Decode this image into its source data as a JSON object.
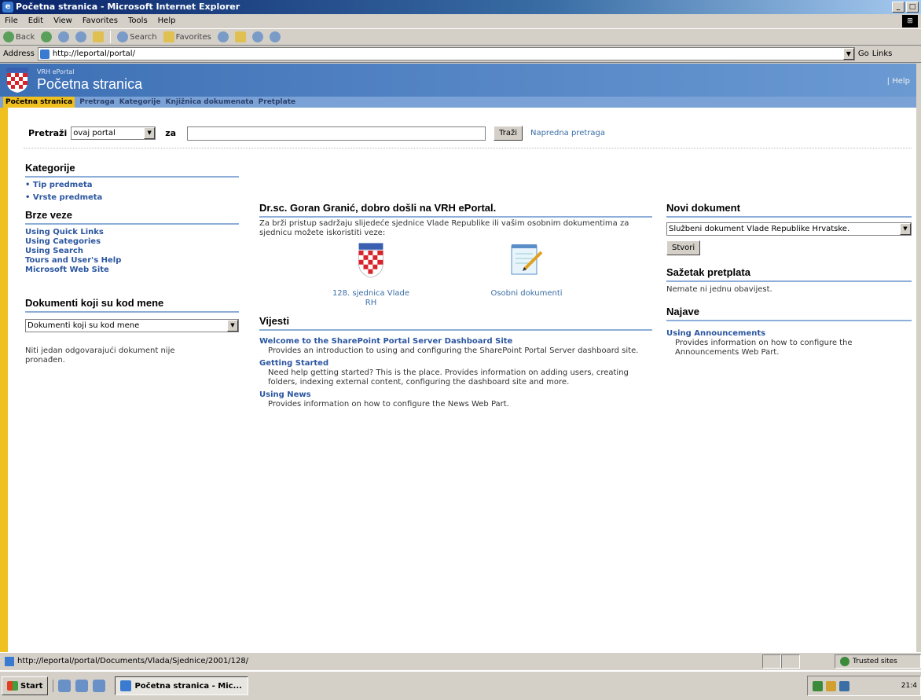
{
  "window": {
    "title": "Početna stranica - Microsoft Internet Explorer",
    "controls": [
      "_",
      "□"
    ]
  },
  "menu": [
    "File",
    "Edit",
    "View",
    "Favorites",
    "Tools",
    "Help"
  ],
  "toolbar": {
    "back": "Back",
    "search": "Search",
    "favorites": "Favorites"
  },
  "address": {
    "label": "Address",
    "url": "http://leportal/portal/",
    "go": "Go",
    "links": "Links"
  },
  "banner": {
    "site": "VRH ePortal",
    "title": "Početna stranica",
    "help": "| Help"
  },
  "nav": [
    "Početna stranica",
    "Pretraga",
    "Kategorije",
    "Knjižnica dokumenata",
    "Pretplate"
  ],
  "search": {
    "label": "Pretraži",
    "scope": "ovaj portal",
    "for": "za",
    "button": "Traži",
    "advanced": "Napredna pretraga"
  },
  "left": {
    "categories_title": "Kategorije",
    "categories": [
      "Tip predmeta",
      "Vrste predmeta"
    ],
    "quick_title": "Brze veze",
    "quick": [
      "Using Quick Links",
      "Using Categories",
      "Using Search",
      "Tours and User's Help",
      "Microsoft Web Site"
    ],
    "docs_title": "Dokumenti koji su kod mene",
    "docs_select": "Dokumenti koji su kod mene",
    "docs_empty": "Niti jedan odgovarajući dokument nije pronađen."
  },
  "center": {
    "welcome_title": "Dr.sc. Goran Granić, dobro došli na VRH ePortal.",
    "welcome_text": "Za brži pristup sadržaju slijedeće sjednice Vlade Republike ili vašim osobnim dokumentima za sjednicu možete iskoristiti veze:",
    "link1": "128. sjednica Vlade RH",
    "link2": "Osobni dokumenti",
    "news_title": "Vijesti",
    "news": [
      {
        "title": "Welcome to the SharePoint Portal Server Dashboard Site",
        "text": "Provides an introduction to using and configuring the SharePoint Portal Server dashboard site."
      },
      {
        "title": "Getting Started",
        "text": "Need help getting started? This is the place. Provides information on adding users, creating folders, indexing external content, configuring the dashboard site and more."
      },
      {
        "title": "Using News",
        "text": "Provides information on how to configure the News Web Part."
      }
    ]
  },
  "right": {
    "new_title": "Novi dokument",
    "new_select": "Službeni dokument Vlade Republike Hrvatske.",
    "create": "Stvori",
    "subs_title": "Sažetak pretplata",
    "subs_text": "Nemate ni jednu obavijest.",
    "ann_title": "Najave",
    "ann_link": "Using Announcements",
    "ann_text": "Provides information on how to configure the Announcements Web Part."
  },
  "status": {
    "url": "http://leportal/portal/Documents/Vlada/Sjednice/2001/128/",
    "zone": "Trusted sites"
  },
  "taskbar": {
    "start": "Start",
    "task": "Početna stranica - Mic...",
    "clock": "21:4"
  },
  "colors": {
    "banner": "#3d6fb5",
    "nav": "#7ba2d6",
    "accent": "#f0c020",
    "link": "#2b56a0"
  }
}
